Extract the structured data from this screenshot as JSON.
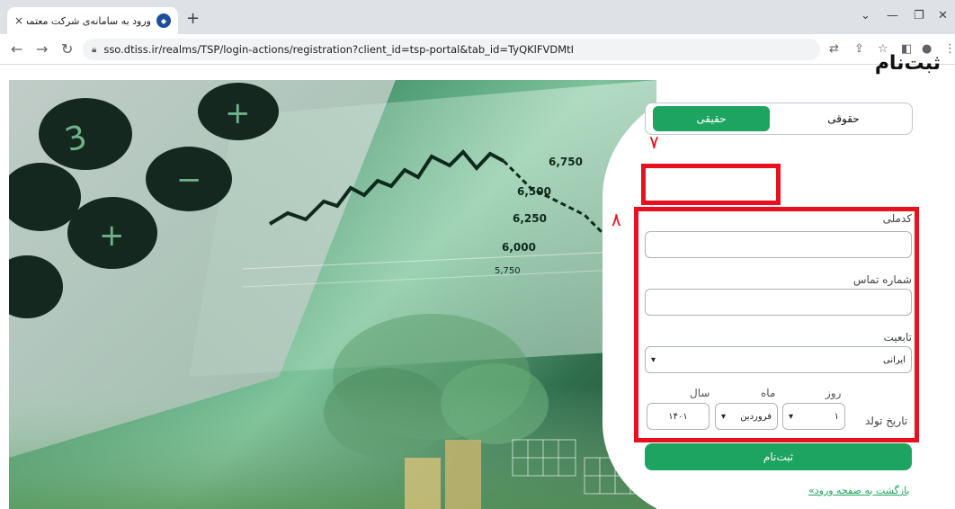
{
  "browser": {
    "tab_title": "ورود به سامانه‌ی شرکت معتمد تیس",
    "tab_close": "×",
    "new_tab": "+",
    "url": "sso.dtiss.ir/realms/TSP/login-actions/registration?client_id=tsp-portal&tab_id=TyQKlFVDMtI"
  },
  "form": {
    "heading": "ثبت‌نام",
    "type_tabs": {
      "real": "حقیقی",
      "legal": "حقوقی"
    },
    "national_code_label": "کدملی",
    "phone_label": "شماره تماس",
    "nationality_label": "تابعیت",
    "nationality_value": "ایرانی",
    "birthdate_label": "تاریخ تولد",
    "day_label": "روز",
    "month_label": "ماه",
    "year_label": "سال",
    "day_value": "۱",
    "month_value": "فروردین",
    "year_value": "۱۴۰۱",
    "submit_label": "ثبت‌نام",
    "back_link": "بازگشت به صفحه ورود»"
  },
  "annotations": {
    "step7": "۷",
    "step8": "۸"
  },
  "hero_texts": {
    "p1": "6,750",
    "p2": "6,500",
    "p3": "6,250",
    "p4": "6,000",
    "p5": "5,750"
  },
  "colors": {
    "accent": "#1ea461",
    "highlight": "#e8101c"
  },
  "icons": [
    "back-arrow-icon",
    "forward-arrow-icon",
    "reload-icon",
    "lock-icon",
    "translate-icon",
    "share-icon",
    "star-icon",
    "sidepanel-icon",
    "profile-icon",
    "menu-icon"
  ]
}
